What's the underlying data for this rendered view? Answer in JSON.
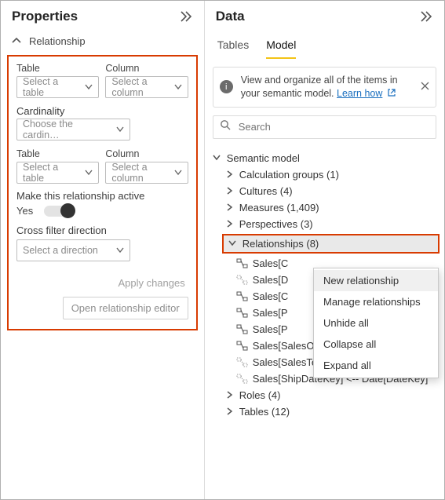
{
  "properties": {
    "title": "Properties",
    "section": "Relationship",
    "form": {
      "table1_label": "Table",
      "column1_label": "Column",
      "table1_placeholder": "Select a table",
      "column1_placeholder": "Select a column",
      "cardinality_label": "Cardinality",
      "cardinality_placeholder": "Choose the cardin…",
      "table2_label": "Table",
      "column2_label": "Column",
      "table2_placeholder": "Select a table",
      "column2_placeholder": "Select a column",
      "active_label": "Make this relationship active",
      "active_value": "Yes",
      "cross_filter_label": "Cross filter direction",
      "cross_filter_placeholder": "Select a direction",
      "apply_label": "Apply changes",
      "open_editor_label": "Open relationship editor"
    }
  },
  "data_panel": {
    "title": "Data",
    "tabs": {
      "tables": "Tables",
      "model": "Model"
    },
    "info_text": "View and organize all of the items in your semantic model. ",
    "info_link": "Learn how",
    "search_placeholder": "Search",
    "tree": {
      "root": "Semantic model",
      "calc_groups": "Calculation groups (1)",
      "cultures": "Cultures (4)",
      "measures": "Measures (1,409)",
      "perspectives": "Perspectives (3)",
      "relationships": "Relationships (8)",
      "roles": "Roles (4)",
      "tables": "Tables (12)",
      "rel_items": [
        "Sales[C",
        "Sales[D",
        "Sales[C",
        "Sales[P",
        "Sales[P",
        "Sales[SalesOrderLineKey] — Sales Or…",
        "Sales[SalesTerritoryKey] <- Sales Te…",
        "Sales[ShipDateKey] <-- Date[DateKey]"
      ]
    },
    "context_menu": {
      "new": "New relationship",
      "manage": "Manage relationships",
      "unhide": "Unhide all",
      "collapse": "Collapse all",
      "expand": "Expand all"
    }
  }
}
